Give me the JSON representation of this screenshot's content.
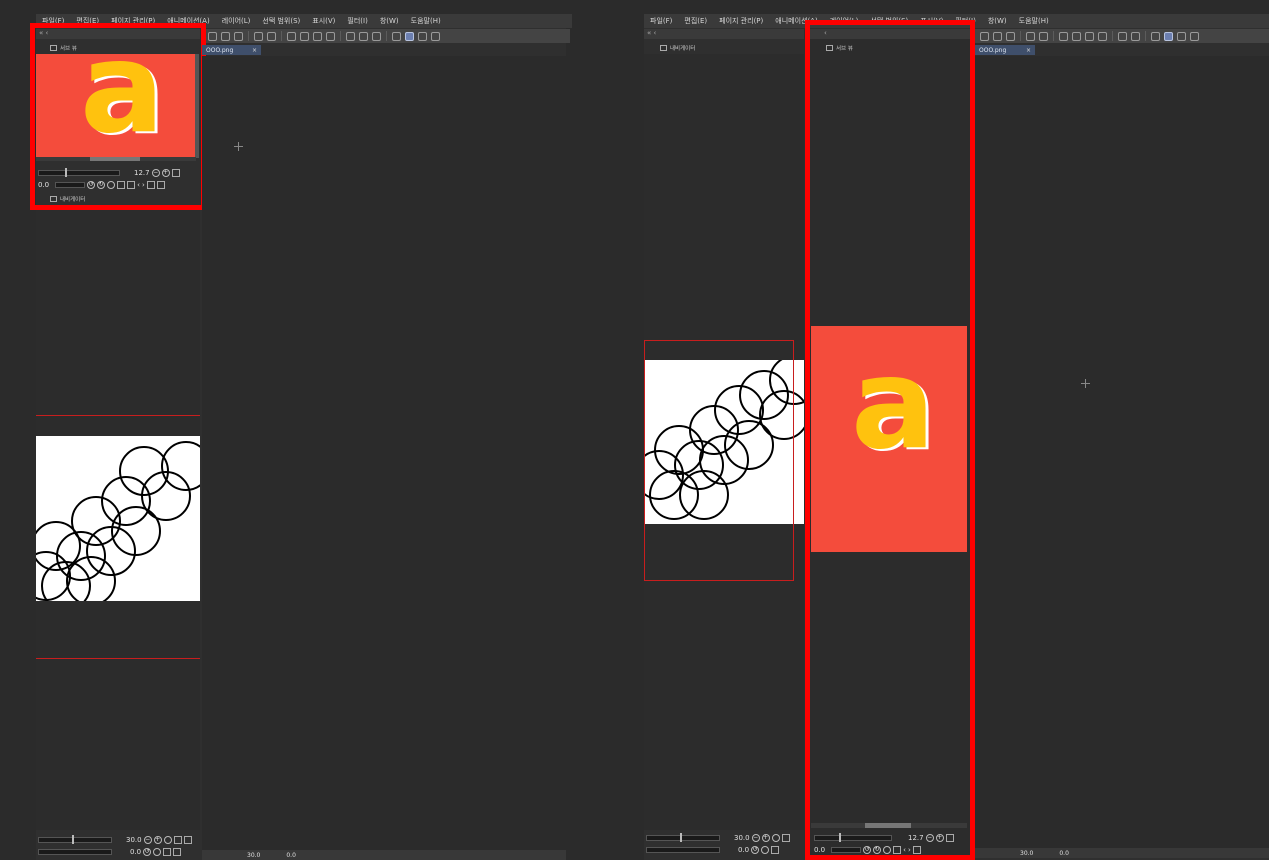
{
  "menu": [
    "파일(F)",
    "편집(E)",
    "페이지 관리(P)",
    "애니메이션(A)",
    "레이어(L)",
    "선택 범위(S)",
    "표시(V)",
    "필터(I)",
    "창(W)",
    "도움말(H)"
  ],
  "document_tab": {
    "label": "OOO.png",
    "close": "×"
  },
  "sub_view_tab": "서브 뷰",
  "navigator_tab": "내비게이터",
  "sub_view": {
    "zoom_value": "12.7",
    "rotate_value": "0.0"
  },
  "navigator": {
    "zoom_value": "30.0",
    "rotate_value": "0.0"
  },
  "preview": {
    "letter": "a",
    "colors": {
      "background": "#f44c3c",
      "letter": "#ffc20e",
      "letter_shadow": "#ffffff"
    }
  },
  "colors": {
    "highlight": "#ff0000",
    "workspace": "#2b2b2b",
    "active_tab": "#3f4f6b"
  }
}
